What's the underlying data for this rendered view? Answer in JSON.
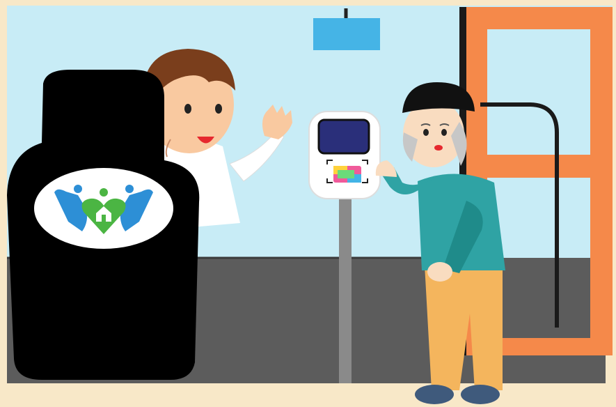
{
  "scene": {
    "description_items": [
      "bus-interior",
      "driver-seat",
      "driver",
      "card-reader",
      "elderly-passenger",
      "bus-door"
    ]
  },
  "colors": {
    "frame": "#f8e8c8",
    "window_sky": "#c8ecf6",
    "floor": "#5c5c5c",
    "door": "#f5894a",
    "sign": "#45b4e6",
    "seat": "#000000",
    "shirt": "#2fa3a4",
    "pants": "#f4b55d",
    "logo_blue": "#2d8fd6",
    "logo_green": "#4bb543"
  },
  "icons": [
    "care-logo-icon",
    "hands-icon",
    "heart-house-icon",
    "card-icon"
  ]
}
